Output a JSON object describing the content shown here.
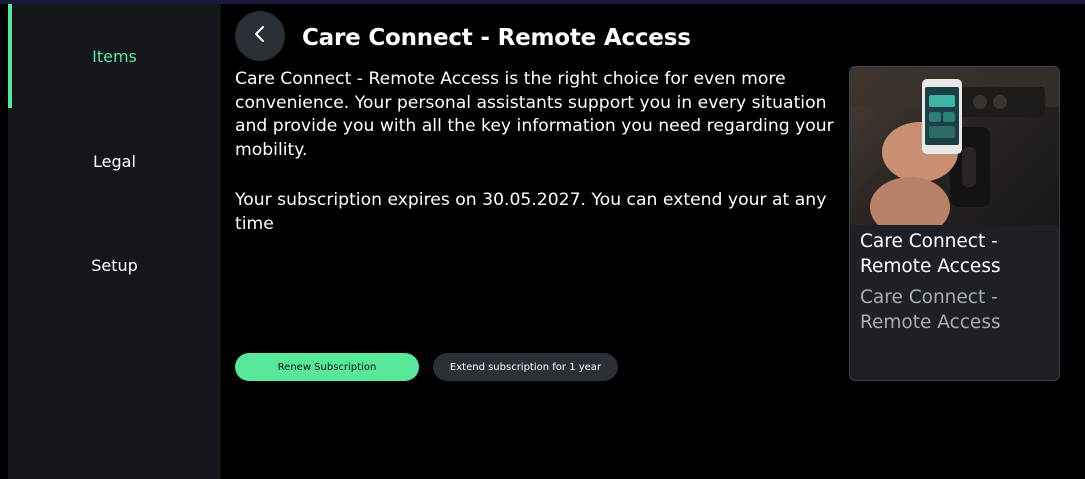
{
  "sidebar": {
    "items": [
      {
        "label": "Items",
        "active": true
      },
      {
        "label": "Legal",
        "active": false
      },
      {
        "label": "Setup",
        "active": false
      }
    ]
  },
  "header": {
    "back_icon": "chevron-left-icon",
    "title": "Care Connect - Remote Access"
  },
  "main": {
    "description": "Care Connect - Remote Access is the right choice for even more convenience. Your personal assistants support you in every situation and provide you with all the key information you need regarding your mobility.",
    "expiry_text": "Your subscription expires on 30.05.2027. You can extend your at any time",
    "buttons": {
      "renew": "Renew Subscription",
      "extend": "Extend subscription for 1 year"
    }
  },
  "card": {
    "title": "Care Connect - Remote Access",
    "subtitle": "Care Connect - Remote Access"
  },
  "colors": {
    "accent": "#58e89a",
    "sidebar_bg": "#13171c",
    "secondary_button": "#2b3037",
    "background": "#000000"
  }
}
